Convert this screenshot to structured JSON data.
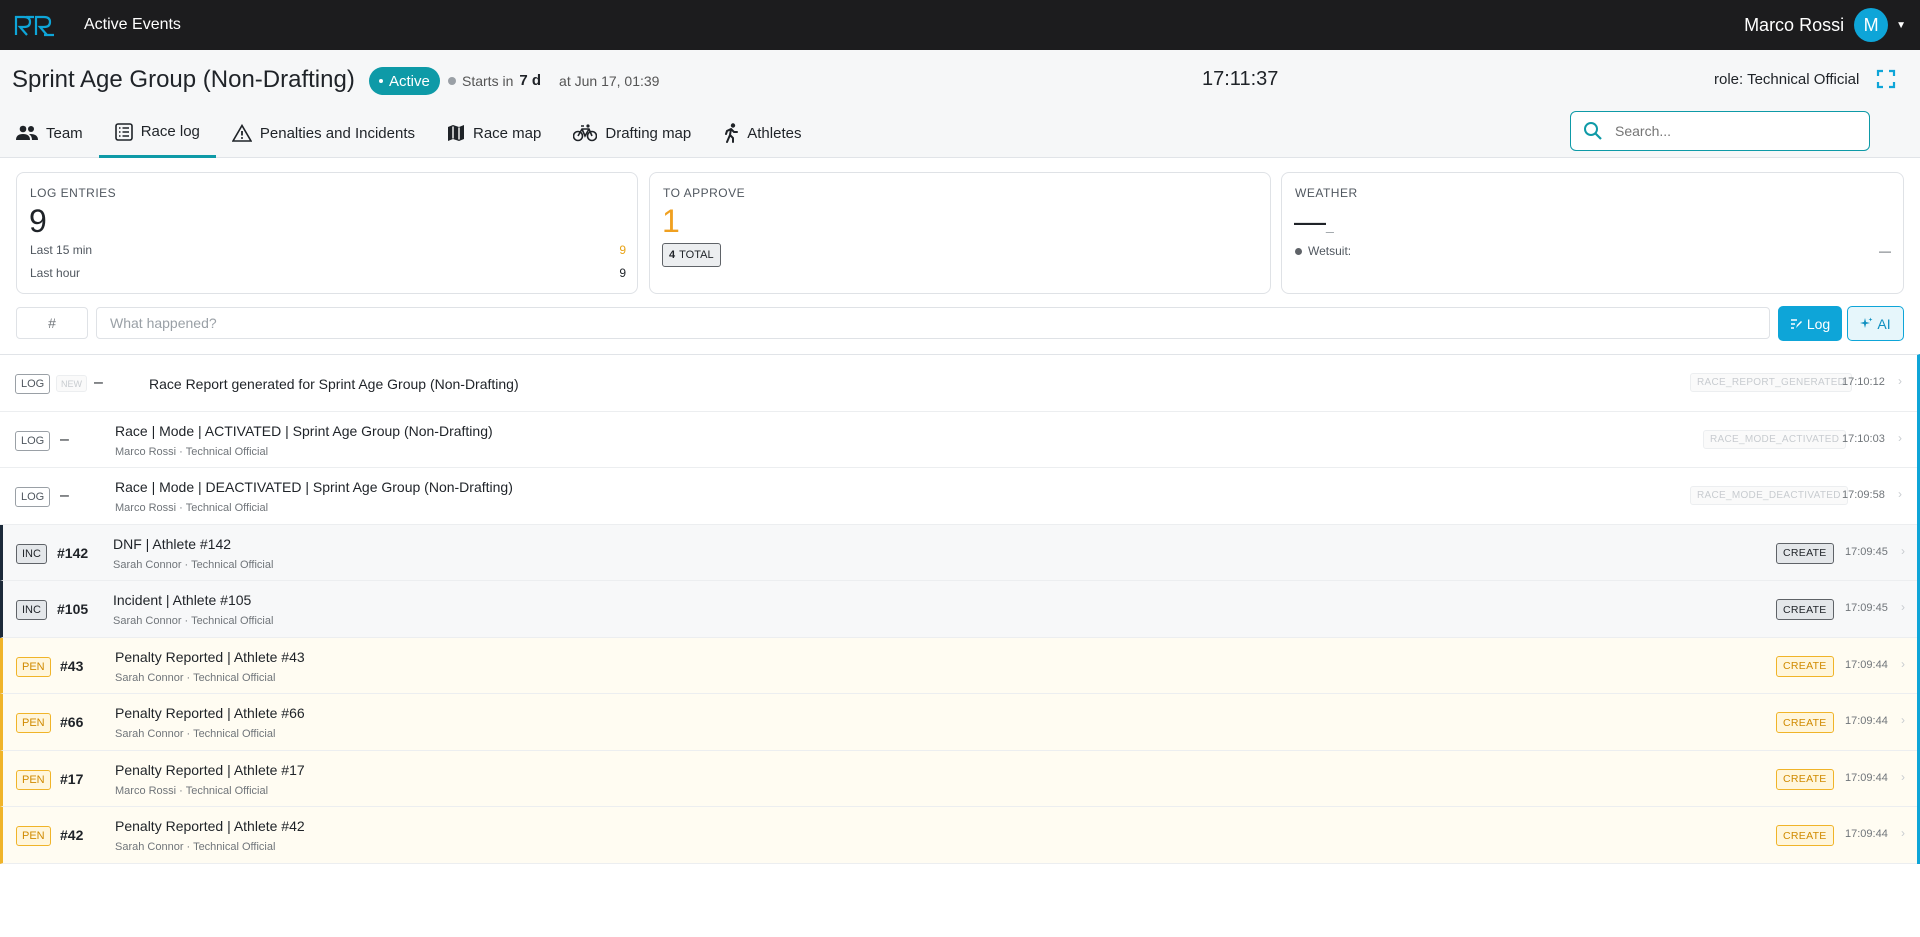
{
  "topbar": {
    "app_title": "Active Events",
    "user_name": "Marco Rossi",
    "avatar_initial": "M"
  },
  "event": {
    "title": "Sprint Age Group (Non-Drafting)",
    "status": "Active",
    "starts_prefix": "Starts in",
    "starts_value": "7 d",
    "starts_at": "at Jun 17, 01:39",
    "clock": "17:11:37",
    "role": "role: Technical Official"
  },
  "tabs": [
    {
      "label": "Team",
      "icon": "team-icon"
    },
    {
      "label": "Race log",
      "icon": "list-icon",
      "active": true
    },
    {
      "label": "Penalties and Incidents",
      "icon": "warning-icon"
    },
    {
      "label": "Race map",
      "icon": "map-icon"
    },
    {
      "label": "Drafting map",
      "icon": "bicycle-icon"
    },
    {
      "label": "Athletes",
      "icon": "runner-icon"
    }
  ],
  "search": {
    "placeholder": "Search..."
  },
  "stats": {
    "log_entries": {
      "label": "LOG ENTRIES",
      "value": "9",
      "last15_label": "Last 15 min",
      "last15_value": "9",
      "lasthour_label": "Last hour",
      "lasthour_value": "9"
    },
    "to_approve": {
      "label": "TO APPROVE",
      "value": "1",
      "total_value": "4",
      "total_label": "TOTAL"
    },
    "weather": {
      "label": "WEATHER",
      "value": "—",
      "sub": "_",
      "wetsuit_label": "Wetsuit:",
      "wetsuit_value": "—"
    }
  },
  "entry": {
    "number_placeholder": "#",
    "text_placeholder": "What happened?",
    "log_label": "Log",
    "ai_label": "AI"
  },
  "colors": {
    "accent": "#0ea5d8",
    "teal": "#0e9aa7",
    "penalty": "#f0b429",
    "incident": "#1c2a3a"
  },
  "log": [
    {
      "type": "LOG",
      "is_new": true,
      "new_label": "NEW",
      "num": "–",
      "title": "Race Report generated for Sprint Age Group (Non-Drafting)",
      "meta": "",
      "code": "RACE_REPORT_GENERATED",
      "time": "17:10:12"
    },
    {
      "type": "LOG",
      "num": "–",
      "title": "Race | Mode | ACTIVATED | Sprint Age Group (Non-Drafting)",
      "meta": "Marco Rossi · Technical Official",
      "code": "RACE_MODE_ACTIVATED",
      "time": "17:10:03"
    },
    {
      "type": "LOG",
      "num": "–",
      "title": "Race | Mode | DEACTIVATED | Sprint Age Group (Non-Drafting)",
      "meta": "Marco Rossi · Technical Official",
      "code": "RACE_MODE_DEACTIVATED",
      "time": "17:09:58"
    },
    {
      "type": "INC",
      "num": "#142",
      "title": "DNF | Athlete #142",
      "meta": "Sarah Connor · Technical Official",
      "action": "CREATE",
      "time": "17:09:45"
    },
    {
      "type": "INC",
      "num": "#105",
      "title": "Incident | Athlete #105",
      "meta": "Sarah Connor · Technical Official",
      "action": "CREATE",
      "time": "17:09:45"
    },
    {
      "type": "PEN",
      "num": "#43",
      "title": "Penalty Reported | Athlete #43",
      "meta": "Sarah Connor · Technical Official",
      "action": "CREATE",
      "time": "17:09:44"
    },
    {
      "type": "PEN",
      "num": "#66",
      "title": "Penalty Reported | Athlete #66",
      "meta": "Sarah Connor · Technical Official",
      "action": "CREATE",
      "time": "17:09:44"
    },
    {
      "type": "PEN",
      "num": "#17",
      "title": "Penalty Reported | Athlete #17",
      "meta": "Marco Rossi · Technical Official",
      "action": "CREATE",
      "time": "17:09:44"
    },
    {
      "type": "PEN",
      "num": "#42",
      "title": "Penalty Reported | Athlete #42",
      "meta": "Sarah Connor · Technical Official",
      "action": "CREATE",
      "time": "17:09:44"
    }
  ]
}
